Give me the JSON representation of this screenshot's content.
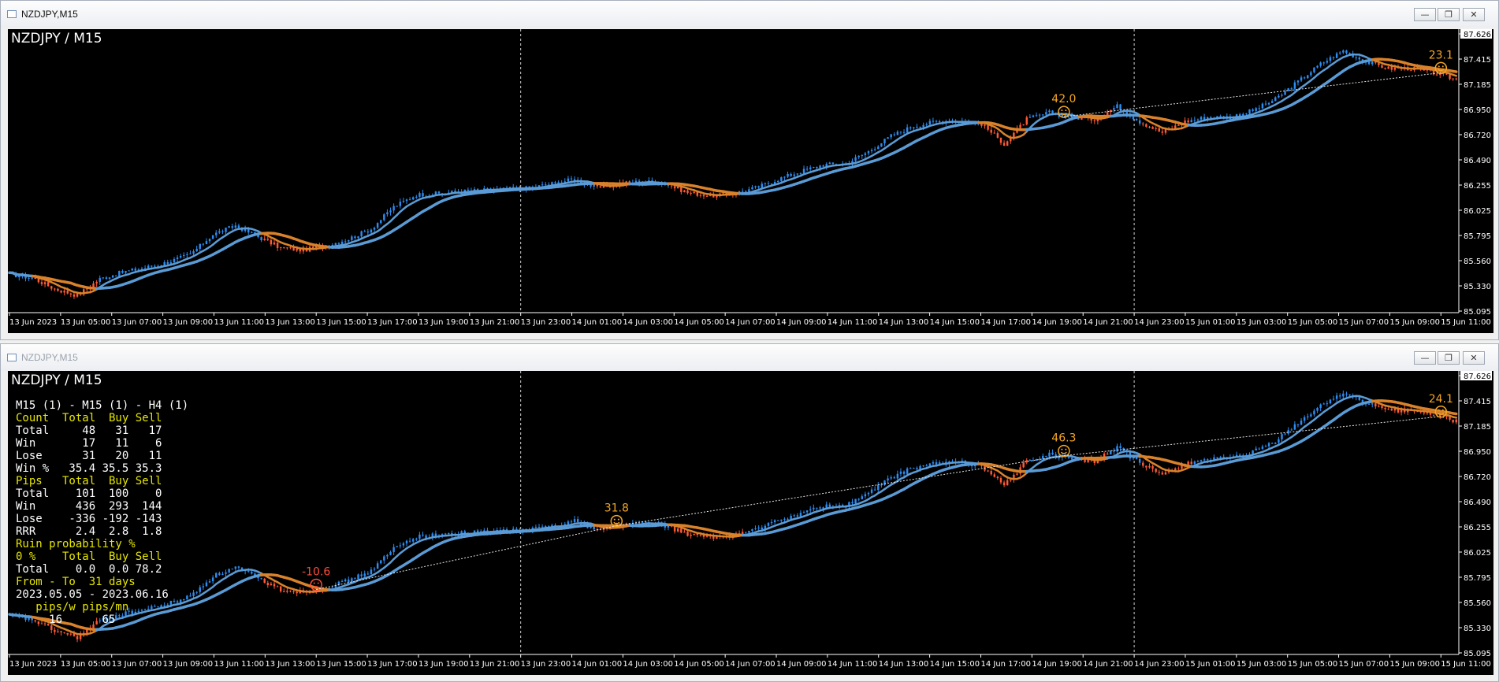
{
  "windows": [
    {
      "title": "NZDJPY,M15",
      "chart_title": "NZDJPY / M15",
      "markers": [
        {
          "label": "42.0",
          "x": "14 Jun 20:15",
          "face": "smile",
          "color": "#f5a623"
        },
        {
          "label": "23.1",
          "x": "15 Jun 11:00",
          "face": "smile",
          "color": "#f5a623"
        }
      ]
    },
    {
      "title": "NZDJPY,M15",
      "chart_title": "NZDJPY / M15",
      "markers": [
        {
          "label": "-10.6",
          "x": "13 Jun 15:00",
          "face": "frown",
          "color": "#ff4b3a"
        },
        {
          "label": "31.8",
          "x": "14 Jun 02:45",
          "face": "smile",
          "color": "#f5a623"
        },
        {
          "label": "46.3",
          "x": "14 Jun 20:15",
          "face": "smile",
          "color": "#f5a623"
        },
        {
          "label": "24.1",
          "x": "15 Jun 11:00",
          "face": "smile",
          "color": "#f5a623"
        }
      ]
    }
  ],
  "window_buttons": {
    "minimize": "—",
    "maximize": "❐",
    "close": "✕"
  },
  "chart_data": {
    "type": "line",
    "symbol": "NZDJPY",
    "timeframe": "M15",
    "price_axis": [
      "87.626",
      "87.415",
      "87.185",
      "86.950",
      "86.720",
      "86.490",
      "86.255",
      "86.025",
      "85.795",
      "85.560",
      "85.330",
      "85.095"
    ],
    "current_price": "87.626",
    "ylim": [
      85.095,
      87.626
    ],
    "time_axis": [
      "13 Jun 2023",
      "13 Jun 05:00",
      "13 Jun 07:00",
      "13 Jun 09:00",
      "13 Jun 11:00",
      "13 Jun 13:00",
      "13 Jun 15:00",
      "13 Jun 17:00",
      "13 Jun 19:00",
      "13 Jun 21:00",
      "13 Jun 23:00",
      "14 Jun 01:00",
      "14 Jun 03:00",
      "14 Jun 05:00",
      "14 Jun 07:00",
      "14 Jun 09:00",
      "14 Jun 11:00",
      "14 Jun 13:00",
      "14 Jun 15:00",
      "14 Jun 17:00",
      "14 Jun 19:00",
      "14 Jun 21:00",
      "14 Jun 23:00",
      "15 Jun 01:00",
      "15 Jun 03:00",
      "15 Jun 05:00",
      "15 Jun 07:00",
      "15 Jun 09:00",
      "15 Jun 11:00"
    ],
    "day_separators": [
      "13 Jun 23:00",
      "14 Jun 23:00"
    ],
    "price_path": [
      85.44,
      85.41,
      85.31,
      85.25,
      85.4,
      85.46,
      85.5,
      85.55,
      85.62,
      85.8,
      85.88,
      85.78,
      85.68,
      85.66,
      85.7,
      85.76,
      85.85,
      86.05,
      86.16,
      86.17,
      86.19,
      86.2,
      86.21,
      86.22,
      86.26,
      86.3,
      86.22,
      86.26,
      86.28,
      86.26,
      86.18,
      86.15,
      86.17,
      86.22,
      86.3,
      86.37,
      86.43,
      86.44,
      86.55,
      86.69,
      86.78,
      86.82,
      86.83,
      86.8,
      86.62,
      86.84,
      86.9,
      86.86,
      86.84,
      86.96,
      86.82,
      86.72,
      86.82,
      86.86,
      86.86,
      86.92,
      87.02,
      87.18,
      87.34,
      87.46,
      87.36,
      87.3,
      87.3,
      87.26,
      87.2
    ],
    "series": [
      {
        "name": "ma-fast",
        "color": "#5b9bd5"
      },
      {
        "name": "ma-slow",
        "color": "#5b9bd5"
      }
    ],
    "colors": {
      "up": "#2d8cf0",
      "down": "#ff5a36",
      "down_ma": "#d9822b",
      "text": "#ffffff",
      "label": "#e6e600"
    }
  },
  "stats": {
    "header": "M15 (1) - M15 (1) - H4 (1)",
    "count_header": [
      "Count",
      "Total",
      "Buy",
      "Sell"
    ],
    "count_rows": [
      [
        "Total",
        "48",
        "31",
        "17"
      ],
      [
        "Win",
        "17",
        "11",
        "6"
      ],
      [
        "Lose",
        "31",
        "20",
        "11"
      ],
      [
        "Win %",
        "35.4",
        "35.5",
        "35.3"
      ]
    ],
    "pips_header": [
      "Pips",
      "Total",
      "Buy",
      "Sell"
    ],
    "pips_rows": [
      [
        "Total",
        "101",
        "100",
        "0"
      ],
      [
        "Win",
        "436",
        "293",
        "144"
      ],
      [
        "Lose",
        "-336",
        "-192",
        "-143"
      ],
      [
        "RRR",
        "2.4",
        "2.8",
        "1.8"
      ]
    ],
    "ruin_title": "Ruin probability %",
    "ruin_header": [
      "0 %",
      "Total",
      "Buy",
      "Sell"
    ],
    "ruin_row": [
      "Total",
      "0.0",
      "0.0",
      "78.2"
    ],
    "period_header": [
      "From - To",
      "31 days"
    ],
    "period": "2023.05.05 - 2023.06.16",
    "rate_header": [
      "pips/w",
      "pips/mn"
    ],
    "rate_values": [
      "16",
      "65"
    ]
  }
}
